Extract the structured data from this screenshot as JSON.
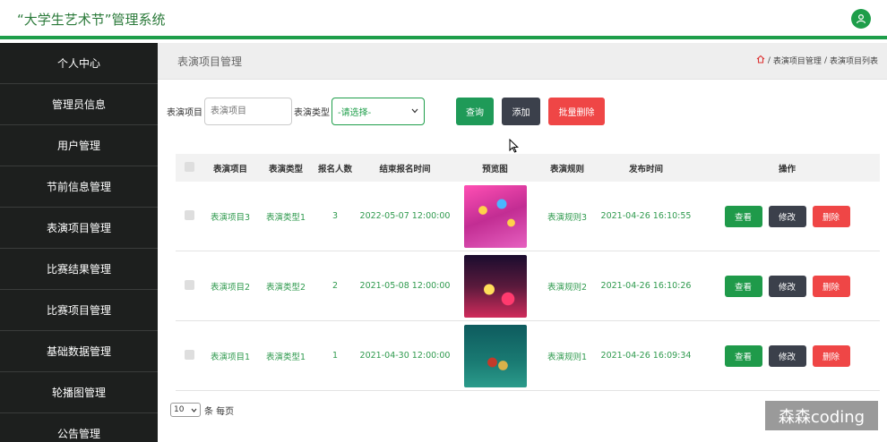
{
  "app": {
    "title": "“大学生艺术节”管理系统"
  },
  "sidebar": {
    "items": [
      {
        "label": "个人中心"
      },
      {
        "label": "管理员信息"
      },
      {
        "label": "用户管理"
      },
      {
        "label": "节前信息管理"
      },
      {
        "label": "表演项目管理"
      },
      {
        "label": "比赛结果管理"
      },
      {
        "label": "比赛项目管理"
      },
      {
        "label": "基础数据管理"
      },
      {
        "label": "轮播图管理"
      },
      {
        "label": "公告管理"
      }
    ]
  },
  "header": {
    "page_title": "表演项目管理",
    "breadcrumb": [
      "表演项目管理",
      "表演项目列表"
    ],
    "breadcrumb_sep": "/"
  },
  "search": {
    "project_label": "表演项目",
    "project_placeholder": "表演项目",
    "type_label": "表演类型",
    "type_selected": "-请选择-",
    "query_label": "查询",
    "add_label": "添加",
    "batch_delete_label": "批量删除"
  },
  "table": {
    "headers": [
      "表演项目",
      "表演类型",
      "报名人数",
      "结束报名时间",
      "预览图",
      "表演规则",
      "发布时间",
      "操作"
    ],
    "rows": [
      {
        "project": "表演项目3",
        "type": "表演类型1",
        "count": "3",
        "end_time": "2022-05-07 12:00:00",
        "rule": "表演规则3",
        "publish_time": "2021-04-26 16:10:55"
      },
      {
        "project": "表演项目2",
        "type": "表演类型2",
        "count": "2",
        "end_time": "2021-05-08 12:00:00",
        "rule": "表演规则2",
        "publish_time": "2021-04-26 16:10:26"
      },
      {
        "project": "表演项目1",
        "type": "表演类型1",
        "count": "1",
        "end_time": "2021-04-30 12:00:00",
        "rule": "表演规则1",
        "publish_time": "2021-04-26 16:09:34"
      }
    ],
    "actions": {
      "view": "查看",
      "edit": "修改",
      "delete": "删除"
    }
  },
  "pager": {
    "page_size": "10",
    "suffix": "条 每页"
  },
  "watermark": {
    "text": "森森coding"
  },
  "colors": {
    "accent": "#1e9e4a",
    "dark": "#3b404b",
    "danger": "#ef4646",
    "sidebar_bg": "#1d1f1e"
  }
}
